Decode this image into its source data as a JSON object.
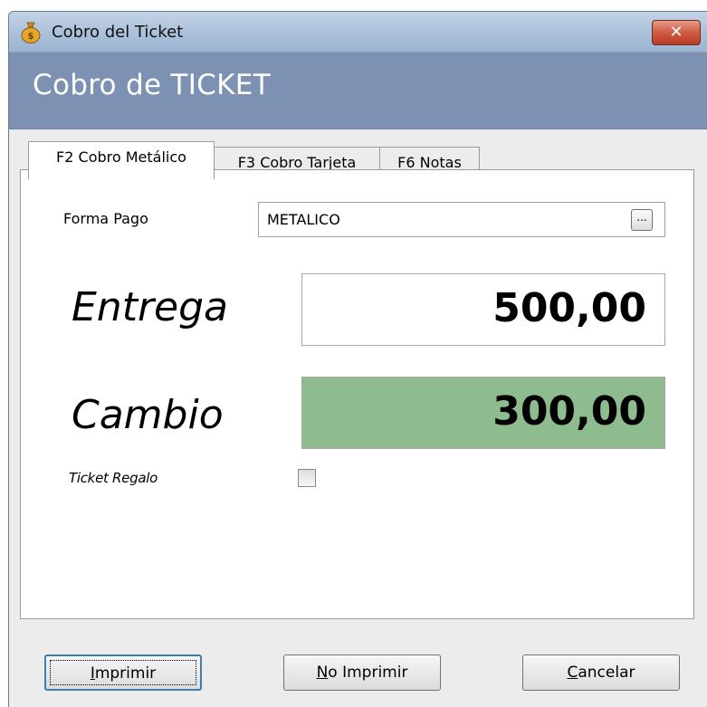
{
  "window": {
    "title": "Cobro del Ticket",
    "icon": "money-bag-icon",
    "close_symbol": "✕"
  },
  "header": {
    "title": "Cobro de TICKET"
  },
  "tabs": [
    {
      "label": "F2 Cobro Metálico",
      "active": true
    },
    {
      "label": "F3 Cobro Tarjeta",
      "active": false
    },
    {
      "label": "F6 Notas",
      "active": false
    }
  ],
  "form": {
    "forma_pago": {
      "label": "Forma Pago",
      "value": "METALICO",
      "button_label": "..."
    },
    "entrega": {
      "label": "Entrega",
      "value": "500,00"
    },
    "cambio": {
      "label": "Cambio",
      "value": "300,00",
      "background": "#8fbc8f"
    },
    "ticket_regalo": {
      "label": "Ticket Regalo",
      "checked": false
    }
  },
  "buttons": {
    "imprimir": {
      "underline": "I",
      "rest": "mprimir"
    },
    "no_imprimir": {
      "underline": "N",
      "rest": "o Imprimir"
    },
    "cancelar": {
      "underline": "C",
      "rest": "ancelar"
    }
  },
  "colors": {
    "header_band": "#7d91b3",
    "cambio_bg": "#8fbc8f",
    "close_button": "#cf5b44"
  }
}
